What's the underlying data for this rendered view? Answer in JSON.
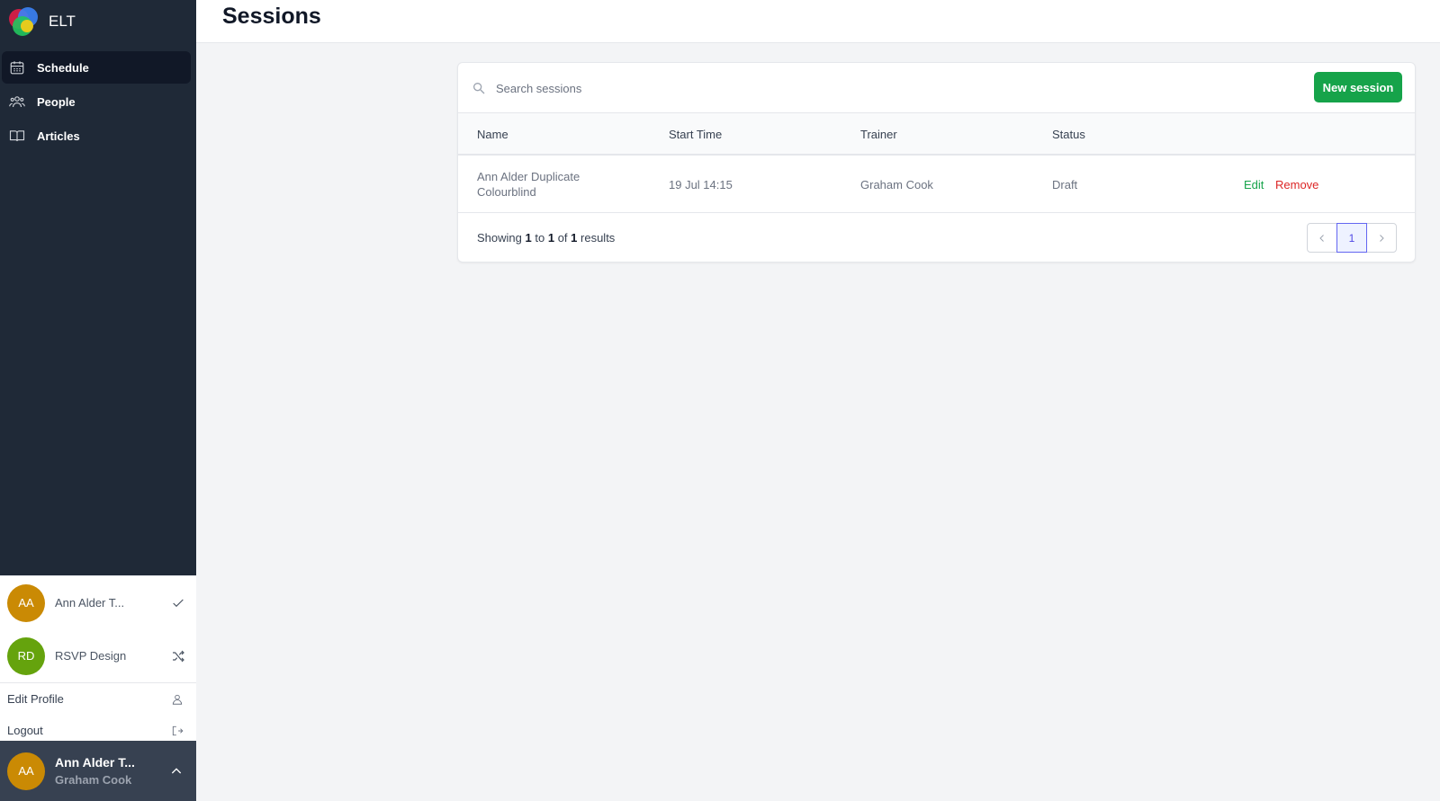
{
  "app": {
    "name": "ELT"
  },
  "sidebar": {
    "items": [
      {
        "label": "Schedule",
        "icon": "calendar-icon",
        "active": true
      },
      {
        "label": "People",
        "icon": "users-icon",
        "active": false
      },
      {
        "label": "Articles",
        "icon": "book-open-icon",
        "active": false
      }
    ]
  },
  "account_menu": {
    "accounts": [
      {
        "initials": "AA",
        "name": "Ann Alder T...",
        "color": "#ca8a04",
        "action_icon": "check-icon"
      },
      {
        "initials": "RD",
        "name": "RSVP Design",
        "color": "#65a30d",
        "action_icon": "shuffle-icon"
      }
    ],
    "links": [
      {
        "label": "Edit Profile",
        "icon": "user-icon"
      },
      {
        "label": "Logout",
        "icon": "logout-icon"
      }
    ]
  },
  "current_user": {
    "initials": "AA",
    "title": "Ann Alder T...",
    "subtitle": "Graham Cook",
    "color": "#ca8a04"
  },
  "header": {
    "title": "Sessions"
  },
  "search": {
    "placeholder": "Search sessions",
    "value": ""
  },
  "toolbar": {
    "new_label": "New session"
  },
  "table": {
    "columns": [
      "Name",
      "Start Time",
      "Trainer",
      "Status"
    ],
    "rows": [
      {
        "name_line1": "Ann Alder Duplicate",
        "name_line2": "Colourblind",
        "start_time": "19 Jul 14:15",
        "trainer": "Graham Cook",
        "status": "Draft",
        "edit_label": "Edit",
        "remove_label": "Remove"
      }
    ]
  },
  "footer": {
    "showing_prefix": "Showing",
    "from": "1",
    "to_word": "to",
    "to": "1",
    "of_word": "of",
    "total": "1",
    "results_word": "results"
  },
  "pagination": {
    "current_page": "1"
  },
  "colors": {
    "accent": "#16a34a",
    "danger": "#dc2626",
    "sidebar": "#1f2937",
    "page_active": "#6366f1"
  }
}
